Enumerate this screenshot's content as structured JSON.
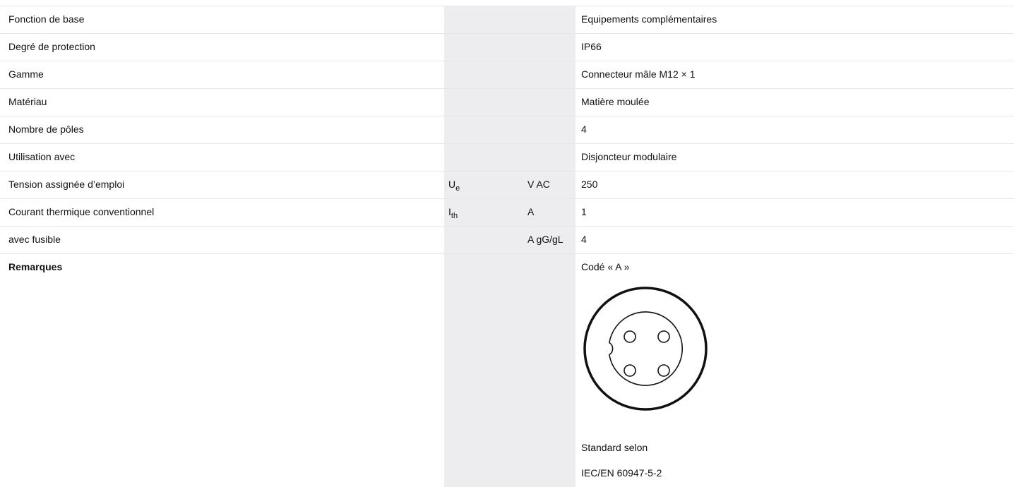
{
  "rows": [
    {
      "label": "Fonction de base",
      "symbol": "",
      "symbol_sub": "",
      "unit": "",
      "value": "Equipements complémentaires"
    },
    {
      "label": "Degré de protection",
      "symbol": "",
      "symbol_sub": "",
      "unit": "",
      "value": "IP66"
    },
    {
      "label": "Gamme",
      "symbol": "",
      "symbol_sub": "",
      "unit": "",
      "value": "Connecteur mâle M12 × 1"
    },
    {
      "label": "Matériau",
      "symbol": "",
      "symbol_sub": "",
      "unit": "",
      "value": "Matière moulée"
    },
    {
      "label": "Nombre de pôles",
      "symbol": "",
      "symbol_sub": "",
      "unit": "",
      "value": "4"
    },
    {
      "label": "Utilisation avec",
      "symbol": "",
      "symbol_sub": "",
      "unit": "",
      "value": "Disjoncteur modulaire"
    },
    {
      "label": "Tension assignée d’emploi",
      "symbol": "U",
      "symbol_sub": "e",
      "unit": "V AC",
      "value": "250"
    },
    {
      "label": "Courant thermique conventionnel",
      "symbol": "I",
      "symbol_sub": "th",
      "unit": "A",
      "value": "1"
    },
    {
      "label": "avec fusible",
      "symbol": "",
      "symbol_sub": "",
      "unit": "A gG/gL",
      "value": "4"
    }
  ],
  "remarks": {
    "label": "Remarques",
    "coding": "Codé « A »",
    "connector_icon": "m12-a-coded-4-pin-connector-icon",
    "standard_label": "Standard selon",
    "standard_value": "IEC/EN 60947-5-2"
  }
}
